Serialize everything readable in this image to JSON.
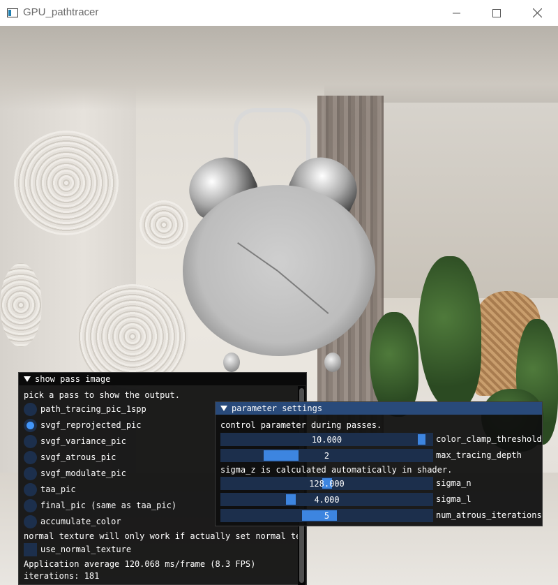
{
  "window": {
    "title": "GPU_pathtracer",
    "minimize_icon": "minimize-icon",
    "maximize_icon": "maximize-icon",
    "close_icon": "close-icon"
  },
  "pass_panel": {
    "title": "show pass image",
    "prompt": "pick a pass to show the output.",
    "options": [
      {
        "label": "path_tracing_pic_1spp",
        "selected": false
      },
      {
        "label": "svgf_reprojected_pic",
        "selected": true
      },
      {
        "label": "svgf_variance_pic",
        "selected": false
      },
      {
        "label": "svgf_atrous_pic",
        "selected": false
      },
      {
        "label": "svgf_modulate_pic",
        "selected": false
      },
      {
        "label": "taa_pic",
        "selected": false
      },
      {
        "label": "final_pic (same as taa_pic)",
        "selected": false
      },
      {
        "label": "accumulate_color",
        "selected": false
      }
    ],
    "normal_note": "normal texture will only work if actually set normal tex",
    "use_normal_texture": {
      "label": "use_normal_texture",
      "checked": false
    },
    "fps_text": "Application average 120.068 ms/frame (8.3 FPS)",
    "iterations_text": "iterations: 181"
  },
  "param_panel": {
    "title": "parameter settings",
    "intro": "control parameter during passes.",
    "sigma_note": "sigma_z is calculated automatically in shader.",
    "sliders": [
      {
        "label": "color_clamp_threshold",
        "value": "10.000",
        "fraction": 0.97
      },
      {
        "label": "max_tracing_depth",
        "value": "2",
        "fraction": 0.24
      },
      {
        "label": "sigma_n",
        "value": "128.000",
        "fraction": 0.5
      },
      {
        "label": "sigma_l",
        "value": "4.000",
        "fraction": 0.32
      },
      {
        "label": "num_atrous_iterations",
        "value": "5",
        "fraction": 0.46
      }
    ]
  },
  "colors": {
    "accent": "#4296fa",
    "frame_bg": "#1c2f4c",
    "header_active": "#294a7a"
  }
}
